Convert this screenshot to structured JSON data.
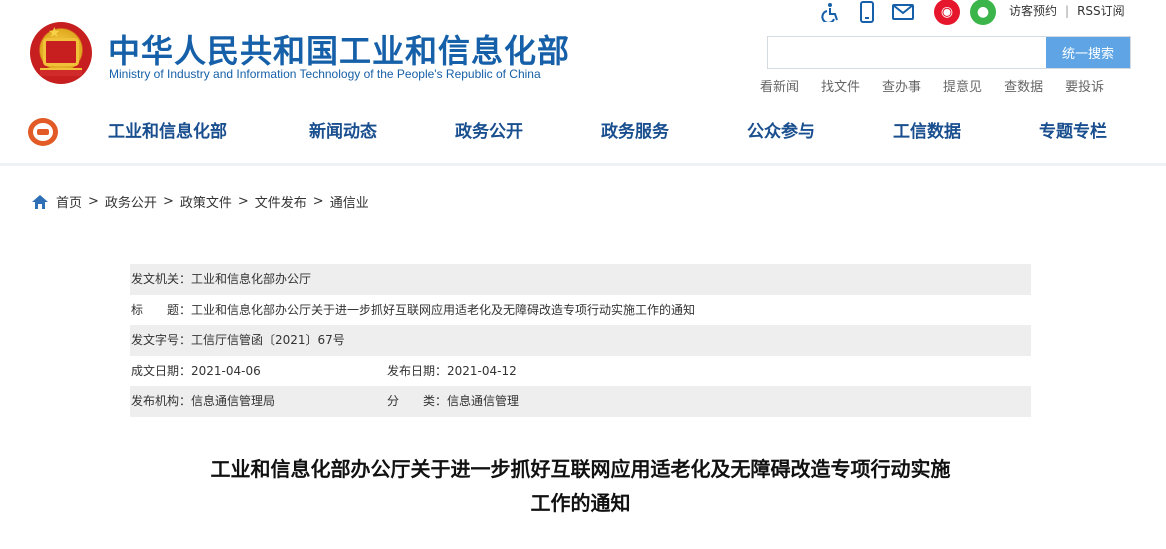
{
  "site": {
    "title": "中华人民共和国工业和信息化部",
    "subtitle": "Ministry of Industry and Information Technology of the People's Republic of China",
    "accent": "#1560a8"
  },
  "top": {
    "icons": [
      "accessibility-icon",
      "mobile-icon",
      "mail-icon",
      "weibo-icon",
      "wechat-icon"
    ],
    "links": [
      "访客预约",
      "RSS订阅"
    ],
    "search_placeholder": "",
    "search_button": "统一搜索",
    "quick_links": [
      "看新闻",
      "找文件",
      "查办事",
      "提意见",
      "查数据",
      "要投诉"
    ]
  },
  "nav": {
    "items": [
      "工业和信息化部",
      "新闻动态",
      "政务公开",
      "政务服务",
      "公众参与",
      "工信数据",
      "专题专栏"
    ]
  },
  "breadcrumb": [
    "首页",
    "政务公开",
    "政策文件",
    "文件发布",
    "通信业"
  ],
  "meta": {
    "issuer": "发文机关：工业和信息化部办公厅",
    "title": "标　　题：工业和信息化部办公厅关于进一步抓好互联网应用适老化及无障碍改造专项行动实施工作的通知",
    "doc_no": "发文字号：工信厅信管函〔2021〕67号",
    "created": "成文日期：2021-04-06",
    "published": "发布日期：2021-04-12",
    "org": "发布机构：信息通信管理局",
    "category": "分　　类：信息通信管理"
  },
  "document": {
    "title_line1": "工业和信息化部办公厅关于进一步抓好互联网应用适老化及无障碍改造专项行动实施",
    "title_line2": "工作的通知"
  }
}
